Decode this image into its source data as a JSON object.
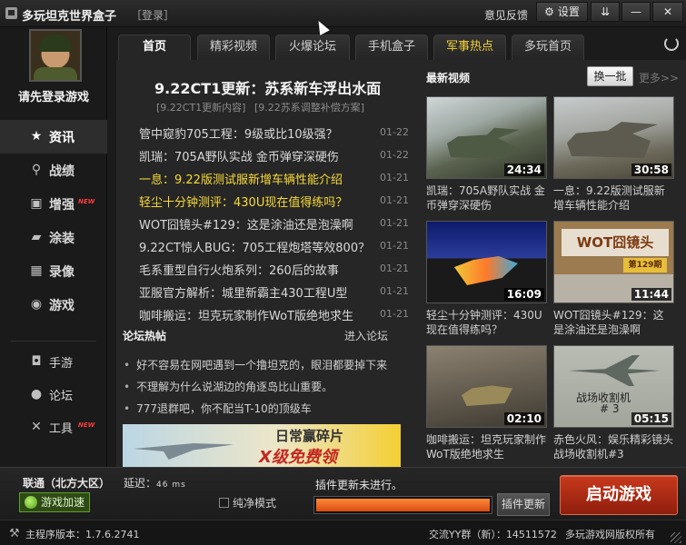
{
  "titlebar": {
    "title": "多玩坦克世界盒子",
    "login": "［登录］",
    "feedback": "意见反馈",
    "settings": "设置",
    "settings_icon": "gear-icon",
    "minimize_icon": "minimize-icon",
    "close_icon": "close-icon"
  },
  "sidebar": {
    "login_prompt": "请先登录游戏",
    "new_badge": "NEW",
    "items": [
      {
        "label": "资讯",
        "icon": "★",
        "active": true
      },
      {
        "label": "战绩",
        "icon": "⚲"
      },
      {
        "label": "增强",
        "icon": "▣",
        "new": true
      },
      {
        "label": "涂装",
        "icon": "▰"
      },
      {
        "label": "录像",
        "icon": "▦"
      },
      {
        "label": "游戏",
        "icon": "◉"
      }
    ],
    "sub_items": [
      {
        "label": "手游",
        "icon": "◘"
      },
      {
        "label": "论坛",
        "icon": "●"
      },
      {
        "label": "工具",
        "icon": "✕",
        "new": true
      }
    ]
  },
  "tabs": [
    {
      "label": "首页",
      "active": true
    },
    {
      "label": "精彩视频"
    },
    {
      "label": "火爆论坛"
    },
    {
      "label": "手机盒子"
    },
    {
      "label": "军事热点",
      "hot": true
    },
    {
      "label": "多玩首页"
    }
  ],
  "news": {
    "headline": "9.22CT1更新：苏系新车浮出水面",
    "subheads": [
      "[9.22CT1更新内容]",
      "[9.22苏系调整补偿方案]"
    ],
    "items": [
      {
        "title": "管中窥豹705工程：9级或比10级强？",
        "date": "01-22"
      },
      {
        "title": "凯瑞：705A野队实战 金币弹穿深硬伤",
        "date": "01-22"
      },
      {
        "title": "一息：9.22版测试服新增车辆性能介绍",
        "date": "01-21",
        "highlight": true
      },
      {
        "title": "轻尘十分钟测评：430U现在值得练吗？",
        "date": "01-21",
        "highlight": true
      },
      {
        "title": "WOT囧镜头#129：这是涂油还是泡澡啊",
        "date": "01-21"
      },
      {
        "title": "9.22CT惊人BUG：705工程炮塔等效800？",
        "date": "01-21"
      },
      {
        "title": "毛系重型自行火炮系列：260后的故事",
        "date": "01-21"
      },
      {
        "title": "亚服官方解析：城里新霸主430工程U型",
        "date": "01-21"
      },
      {
        "title": "咖啡搬运：坦克玩家制作WoT版绝地求生",
        "date": "01-21"
      }
    ]
  },
  "forum": {
    "title": "论坛热帖",
    "more": "进入论坛",
    "posts": [
      "好不容易在网吧遇到一个撸坦克的，眼泪都要掉下来",
      "不理解为什么说湖边的角逐岛比山重要。",
      "777退群吧，你不配当T-10的顶级车"
    ]
  },
  "banner": {
    "line1": "日常赢碎片",
    "line2": "X级免费领"
  },
  "videos": {
    "title": "最新视频",
    "refresh": "换一批",
    "more": "更多>>",
    "items": [
      {
        "duration": "24:34",
        "caption": "凯瑞：705A野队实战 金币弹穿深硬伤"
      },
      {
        "duration": "30:58",
        "caption": "一息：9.22版测试服新增车辆性能介绍"
      },
      {
        "duration": "16:09",
        "caption": "轻尘十分钟测评：430U现在值得练吗？"
      },
      {
        "duration": "11:44",
        "caption": "WOT囧镜头#129：这是涂油还是泡澡啊",
        "thumb_text": "WOT囧镜头",
        "thumb_badge": "第129期"
      },
      {
        "duration": "02:10",
        "caption": "咖啡搬运：坦克玩家制作WoT版绝地求生"
      },
      {
        "duration": "05:15",
        "caption": "赤色火风：娱乐精彩镜头战场收割机#3",
        "thumb_text": "战场收割机",
        "thumb_badge": "# 3"
      }
    ]
  },
  "status": {
    "server": "联通（北方大区）",
    "accelerate": "游戏加速",
    "latency_label": "延迟：",
    "latency_value": "46 ms",
    "pure_mode": "纯净模式",
    "plugin_status": "插件更新未进行。",
    "plugin_progress": 1.0,
    "plugin_update": "插件更新",
    "start_game": "启动游戏"
  },
  "footer": {
    "version": "主程序版本：1.7.6.2741",
    "qq_group": "交流YY群（新）：14511572",
    "copyright": "多玩游戏网版权所有"
  }
}
